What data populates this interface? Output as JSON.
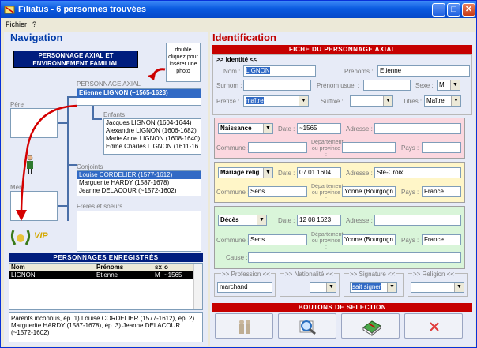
{
  "window": {
    "title": "Filiatus - 6 personnes trouvées",
    "minimize": "_",
    "maximize": "□",
    "close": "✕"
  },
  "menu": [
    "Fichier",
    "?"
  ],
  "navigation": {
    "title": "Navigation",
    "header": "PERSONNAGE AXIAL ET ENVIRONNEMENT FAMILIAL",
    "hint": "double cliquez pour insérer une photo",
    "axial_label": "PERSONNAGE AXIAL",
    "axial_name": "Etienne LIGNON (~1565-1623)",
    "pere_label": "Père",
    "mere_label": "Mère",
    "enfants_label": "Enfants",
    "enfants": [
      "Jacques LIGNON (1604-1644)",
      "Alexandre LIGNON (1606-1682)",
      "Marie Anne LIGNON (1608-1640)",
      "Edme Charles LIGNON (1611-16"
    ],
    "conjoints_label": "Conjoints",
    "conjoints": [
      "Louise CORDELIER (1577-1612)",
      "Marguerite HARDY (1587-1678)",
      "Jeanne DELACOUR (~1572-1602)"
    ],
    "freres_label": "Frères et soeurs",
    "vip": "VIP"
  },
  "registered": {
    "title": "PERSONNAGES ENREGISTRÉS",
    "columns": [
      "Nom",
      "Prénoms",
      "sx",
      "o"
    ],
    "rows": [
      {
        "nom": "LIGNON",
        "prenoms": "Etienne",
        "sx": "M",
        "o": "~1565"
      }
    ],
    "summary": "Parents inconnus, ép. 1) Louise CORDELIER (1577-1612), ép. 2) Marguerite HARDY (1587-1678), ép. 3) Jeanne DELACOUR (~1572-1602)"
  },
  "identification": {
    "title": "Identification",
    "fiche": "FICHE DU PERSONNAGE AXIAL",
    "identite": ">> Identité <<",
    "nom_label": "Nom :",
    "nom": "LIGNON",
    "prenoms_label": "Prénoms :",
    "prenoms": "Etienne",
    "surnom_label": "Surnom :",
    "prenom_usuel_label": "Prénom usuel :",
    "sexe_label": "Sexe :",
    "sexe": "M",
    "prefixe_label": "Préfixe :",
    "prefixe": "maître",
    "suffixe_label": "Suffixe :",
    "titres_label": "Titres :",
    "titres": "Maître",
    "date_label": "Date :",
    "adresse_label": "Adresse :",
    "commune_label": "Commune :",
    "departement_label": "Département ou province :",
    "pays_label": "Pays :",
    "cause_label": "Cause :",
    "naissance": {
      "type": "Naissance",
      "date": "~1565",
      "adresse": "",
      "commune": "",
      "departement": "",
      "pays": ""
    },
    "mariage": {
      "type": "Mariage relig",
      "date": "07 01 1604",
      "adresse": "Ste-Croix",
      "commune": "Sens",
      "departement": "Yonne (Bourgogn",
      "pays": "France"
    },
    "deces": {
      "type": "Décès",
      "date": "12 08 1623",
      "adresse": "",
      "commune": "Sens",
      "departement": "Yonne (Bourgogn",
      "pays": "France"
    },
    "profession_label": ">> Profession <<",
    "profession": "marchand",
    "nationalite_label": ">> Nationalité <<",
    "signature_label": ">> Signature <<",
    "signature": "sait signer",
    "religion_label": ">> Religion <<",
    "boutons": "BOUTONS DE SELECTION"
  },
  "colors": {
    "naissance": "#fbd7df",
    "mariage": "#fff6c8",
    "deces": "#d9f5d9",
    "accent_red": "#c60000",
    "accent_blue": "#003ba8"
  }
}
